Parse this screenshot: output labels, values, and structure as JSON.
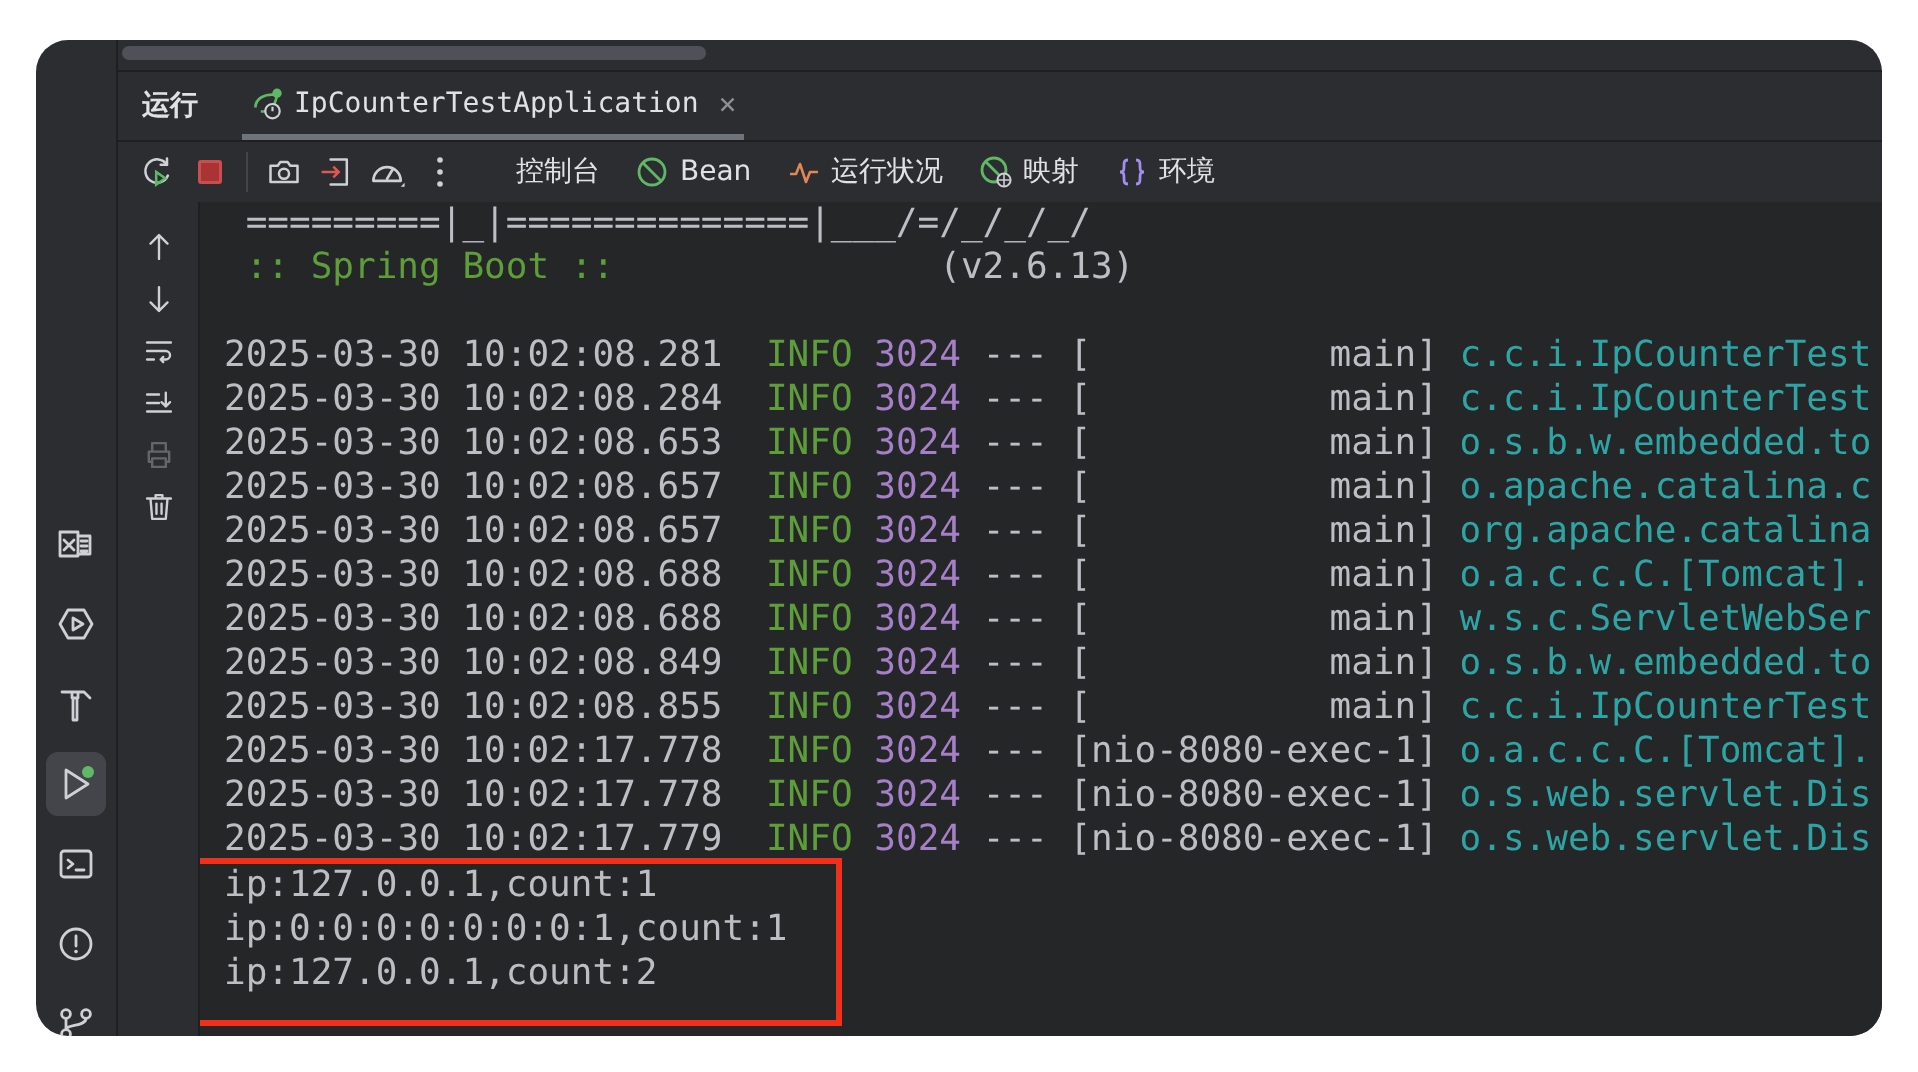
{
  "tool_window_bar": [
    {
      "kind": "spreadsheet",
      "selected": false
    },
    {
      "kind": "services",
      "selected": false
    },
    {
      "kind": "build",
      "selected": false
    },
    {
      "kind": "run",
      "selected": true
    },
    {
      "kind": "terminal",
      "selected": false
    },
    {
      "kind": "problems",
      "selected": false
    },
    {
      "kind": "git",
      "selected": false
    }
  ],
  "run_panel": {
    "title": "运行",
    "tabs": [
      {
        "label": "IpCounterTestApplication",
        "close": "×",
        "selected": true
      }
    ]
  },
  "view_tabs": [
    {
      "kind": "console",
      "label": "控制台"
    },
    {
      "kind": "bean",
      "label": "Bean"
    },
    {
      "kind": "health",
      "label": "运行状况"
    },
    {
      "kind": "mappings",
      "label": "映射"
    },
    {
      "kind": "environment",
      "label": "环境"
    }
  ],
  "console_tools": [
    {
      "kind": "up",
      "disabled": false
    },
    {
      "kind": "down",
      "disabled": false
    },
    {
      "kind": "wrap",
      "disabled": false
    },
    {
      "kind": "scroll-end",
      "disabled": false
    },
    {
      "kind": "print",
      "disabled": true
    },
    {
      "kind": "clear",
      "disabled": false
    }
  ],
  "banner": {
    "art": "=========|_|==============|___/=/_/_/_/",
    "title": ":: Spring Boot ::",
    "version": "(v2.6.13)"
  },
  "log_lines": [
    {
      "timestamp": "2025-03-30 10:02:08.281",
      "level": "INFO",
      "pid": "3024",
      "separator": "---",
      "thread": "[           main]",
      "logger": "c.c.i.IpCounterTest"
    },
    {
      "timestamp": "2025-03-30 10:02:08.284",
      "level": "INFO",
      "pid": "3024",
      "separator": "---",
      "thread": "[           main]",
      "logger": "c.c.i.IpCounterTest"
    },
    {
      "timestamp": "2025-03-30 10:02:08.653",
      "level": "INFO",
      "pid": "3024",
      "separator": "---",
      "thread": "[           main]",
      "logger": "o.s.b.w.embedded.to"
    },
    {
      "timestamp": "2025-03-30 10:02:08.657",
      "level": "INFO",
      "pid": "3024",
      "separator": "---",
      "thread": "[           main]",
      "logger": "o.apache.catalina.c"
    },
    {
      "timestamp": "2025-03-30 10:02:08.657",
      "level": "INFO",
      "pid": "3024",
      "separator": "---",
      "thread": "[           main]",
      "logger": "org.apache.catalina"
    },
    {
      "timestamp": "2025-03-30 10:02:08.688",
      "level": "INFO",
      "pid": "3024",
      "separator": "---",
      "thread": "[           main]",
      "logger": "o.a.c.c.C.[Tomcat]."
    },
    {
      "timestamp": "2025-03-30 10:02:08.688",
      "level": "INFO",
      "pid": "3024",
      "separator": "---",
      "thread": "[           main]",
      "logger": "w.s.c.ServletWebSer"
    },
    {
      "timestamp": "2025-03-30 10:02:08.849",
      "level": "INFO",
      "pid": "3024",
      "separator": "---",
      "thread": "[           main]",
      "logger": "o.s.b.w.embedded.to"
    },
    {
      "timestamp": "2025-03-30 10:02:08.855",
      "level": "INFO",
      "pid": "3024",
      "separator": "---",
      "thread": "[           main]",
      "logger": "c.c.i.IpCounterTest"
    },
    {
      "timestamp": "2025-03-30 10:02:17.778",
      "level": "INFO",
      "pid": "3024",
      "separator": "---",
      "thread": "[nio-8080-exec-1]",
      "logger": "o.a.c.c.C.[Tomcat]."
    },
    {
      "timestamp": "2025-03-30 10:02:17.778",
      "level": "INFO",
      "pid": "3024",
      "separator": "---",
      "thread": "[nio-8080-exec-1]",
      "logger": "o.s.web.servlet.Dis"
    },
    {
      "timestamp": "2025-03-30 10:02:17.779",
      "level": "INFO",
      "pid": "3024",
      "separator": "---",
      "thread": "[nio-8080-exec-1]",
      "logger": "o.s.web.servlet.Dis"
    }
  ],
  "output": {
    "highlighted": true,
    "lines": [
      "ip:127.0.0.1,count:1",
      "ip:0:0:0:0:0:0:0:1,count:1",
      "ip:127.0.0.1,count:2"
    ]
  }
}
